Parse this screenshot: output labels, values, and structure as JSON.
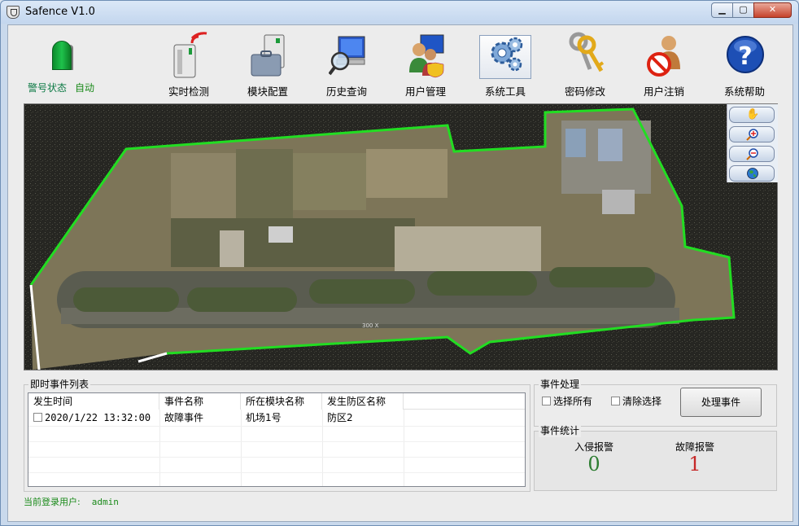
{
  "window": {
    "title": "Safence V1.0"
  },
  "status": {
    "label": "警号状态",
    "mode": "自动"
  },
  "toolbar": [
    {
      "label": "实时检测",
      "icon": "realtime-detect-icon"
    },
    {
      "label": "模块配置",
      "icon": "module-config-icon"
    },
    {
      "label": "历史查询",
      "icon": "history-query-icon"
    },
    {
      "label": "用户管理",
      "icon": "user-manage-icon"
    },
    {
      "label": "系统工具",
      "icon": "system-tools-icon"
    },
    {
      "label": "密码修改",
      "icon": "password-change-icon"
    },
    {
      "label": "用户注销",
      "icon": "user-logout-icon"
    },
    {
      "label": "系统帮助",
      "icon": "system-help-icon"
    }
  ],
  "map": {
    "tools": [
      "pan-hand-icon",
      "zoom-in-icon",
      "zoom-out-icon",
      "globe-icon"
    ],
    "boundary_color": "#22dd22",
    "runway_marking": "300 X"
  },
  "event_list": {
    "title": "即时事件列表",
    "columns": [
      "发生时间",
      "事件名称",
      "所在模块名称",
      "发生防区名称"
    ],
    "rows": [
      {
        "time": "2020/1/22 13:32:00",
        "name": "故障事件",
        "module": "机场1号",
        "zone": "防区2"
      }
    ]
  },
  "event_handling": {
    "title": "事件处理",
    "select_all": "选择所有",
    "clear_selection": "清除选择",
    "process_button": "处理事件"
  },
  "event_stats": {
    "title": "事件统计",
    "intrusion_label": "入侵报警",
    "intrusion_count": "0",
    "intrusion_color": "#2e7d32",
    "fault_label": "故障报警",
    "fault_count": "1",
    "fault_color": "#c62828"
  },
  "login": {
    "label": "当前登录用户:",
    "user": "admin"
  }
}
